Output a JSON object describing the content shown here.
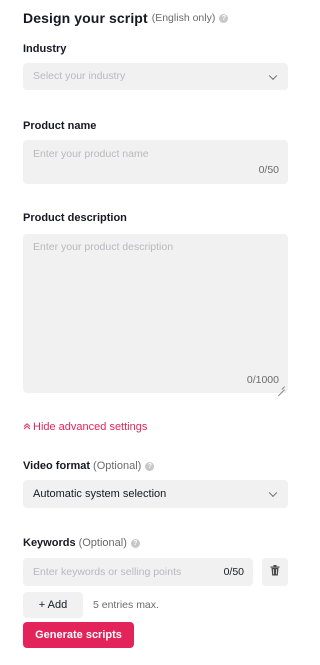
{
  "header": {
    "title": "Design your script",
    "subtitle": "(English only)",
    "info_icon": "question-icon"
  },
  "industry": {
    "label": "Industry",
    "placeholder": "Select your industry",
    "icon": "chevron-down-icon"
  },
  "product_name": {
    "label": "Product name",
    "placeholder": "Enter your product name",
    "counter": "0/50"
  },
  "product_description": {
    "label": "Product description",
    "placeholder": "Enter your product description",
    "counter": "0/1000"
  },
  "advanced": {
    "toggle_label": "Hide advanced settings",
    "icon": "chevron-up-icon",
    "color": "#e3245a"
  },
  "video_format": {
    "label": "Video format",
    "optional": "(Optional)",
    "value": "Automatic system selection",
    "icon": "chevron-down-icon"
  },
  "keywords": {
    "label": "Keywords",
    "optional": "(Optional)",
    "placeholder": "Enter keywords or selling points",
    "counter": "0/50",
    "delete_icon": "trash-icon",
    "add_label": "+ Add",
    "max_note": "5 entries max."
  },
  "actions": {
    "generate_label": "Generate scripts",
    "accent_color": "#e3245a"
  }
}
